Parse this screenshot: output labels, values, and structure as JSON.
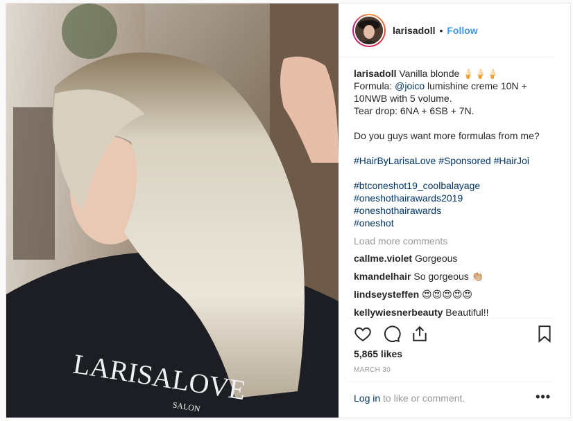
{
  "header": {
    "username": "larisadoll",
    "separator": "•",
    "follow_label": "Follow"
  },
  "photo": {
    "apron_text": "LARISALOVE",
    "apron_subtext": "SALON"
  },
  "caption": {
    "username": "larisadoll",
    "line1": "Vanilla blonde 🍦🍦🍦",
    "line2_prefix": "Formula: ",
    "line2_mention": "@joico",
    "line2_suffix": " lumishine creme 10N +",
    "line3": "10NWB with 5 volume.",
    "line4": "Tear drop: 6NA + 6SB + 7N.",
    "line5": "Do you guys want more formulas from me?",
    "hashtags1": [
      "#HairByLarisaLove",
      "#Sponsored",
      "#HairJoi"
    ],
    "hashtags2": [
      "#btconeshot19_coolbalayage",
      "#oneshothairawards2019",
      "#oneshothairawards",
      "#oneshot"
    ]
  },
  "load_more": "Load more comments",
  "comments": [
    {
      "user": "callme.violet",
      "text": "Gorgeous"
    },
    {
      "user": "kmandelhair",
      "text": "So gorgeous 👏🏼"
    },
    {
      "user": "lindseysteffen",
      "text": "😍😍😍😍😍"
    },
    {
      "user": "kellywiesnerbeauty",
      "text": "Beautiful!!"
    }
  ],
  "likes": "5,865 likes",
  "date": "MARCH 30",
  "footer": {
    "login_link": "Log in",
    "login_text": " to like or comment.",
    "more": "•••"
  },
  "icons": {
    "like": "heart-icon",
    "comment": "comment-icon",
    "share": "share-icon",
    "save": "bookmark-icon",
    "more": "more-options-icon"
  }
}
